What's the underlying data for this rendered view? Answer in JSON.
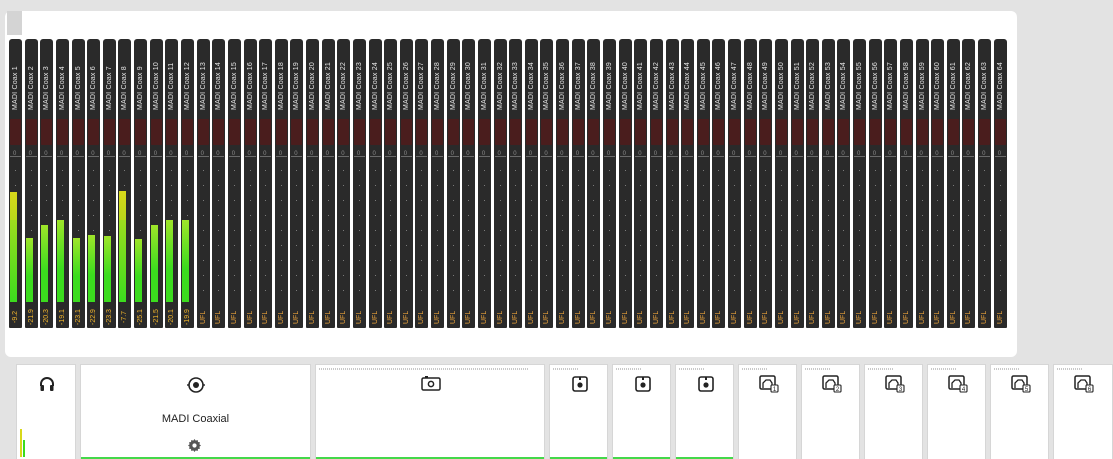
{
  "meter_panel": {
    "channels": [
      {
        "name": "MADI Coax 1",
        "value": "-9.2",
        "level": 0.7,
        "peak_yellow": true
      },
      {
        "name": "MADI Coax 2",
        "value": "-21.9",
        "level": 0.41,
        "peak_yellow": false
      },
      {
        "name": "MADI Coax 3",
        "value": "-20.3",
        "level": 0.49,
        "peak_yellow": false
      },
      {
        "name": "MADI Coax 4",
        "value": "-19.1",
        "level": 0.52,
        "peak_yellow": false
      },
      {
        "name": "MADI Coax 5",
        "value": "-23.1",
        "level": 0.41,
        "peak_yellow": false
      },
      {
        "name": "MADI Coax 6",
        "value": "-22.9",
        "level": 0.43,
        "peak_yellow": false
      },
      {
        "name": "MADI Coax 7",
        "value": "-23.3",
        "level": 0.42,
        "peak_yellow": false
      },
      {
        "name": "MADI Coax 8",
        "value": "-7.7",
        "level": 0.71,
        "peak_yellow": true
      },
      {
        "name": "MADI Coax 9",
        "value": "-25.1",
        "level": 0.4,
        "peak_yellow": false
      },
      {
        "name": "MADI Coax 10",
        "value": "-21.5",
        "level": 0.49,
        "peak_yellow": false
      },
      {
        "name": "MADI Coax 11",
        "value": "-20.1",
        "level": 0.52,
        "peak_yellow": false
      },
      {
        "name": "MADI Coax 12",
        "value": "-19.9",
        "level": 0.52,
        "peak_yellow": false
      },
      {
        "name": "MADI Coax 13",
        "value": "UFL",
        "level": 0
      },
      {
        "name": "MADI Coax 14",
        "value": "UFL",
        "level": 0
      },
      {
        "name": "MADI Coax 15",
        "value": "UFL",
        "level": 0
      },
      {
        "name": "MADI Coax 16",
        "value": "UFL",
        "level": 0
      },
      {
        "name": "MADI Coax 17",
        "value": "UFL",
        "level": 0
      },
      {
        "name": "MADI Coax 18",
        "value": "UFL",
        "level": 0
      },
      {
        "name": "MADI Coax 19",
        "value": "UFL",
        "level": 0
      },
      {
        "name": "MADI Coax 20",
        "value": "UFL",
        "level": 0
      },
      {
        "name": "MADI Coax 21",
        "value": "UFL",
        "level": 0
      },
      {
        "name": "MADI Coax 22",
        "value": "UFL",
        "level": 0
      },
      {
        "name": "MADI Coax 23",
        "value": "UFL",
        "level": 0
      },
      {
        "name": "MADI Coax 24",
        "value": "UFL",
        "level": 0
      },
      {
        "name": "MADI Coax 25",
        "value": "UFL",
        "level": 0
      },
      {
        "name": "MADI Coax 26",
        "value": "UFL",
        "level": 0
      },
      {
        "name": "MADI Coax 27",
        "value": "UFL",
        "level": 0
      },
      {
        "name": "MADI Coax 28",
        "value": "UFL",
        "level": 0
      },
      {
        "name": "MADI Coax 29",
        "value": "UFL",
        "level": 0
      },
      {
        "name": "MADI Coax 30",
        "value": "UFL",
        "level": 0
      },
      {
        "name": "MADI Coax 31",
        "value": "UFL",
        "level": 0
      },
      {
        "name": "MADI Coax 32",
        "value": "UFL",
        "level": 0
      },
      {
        "name": "MADI Coax 33",
        "value": "UFL",
        "level": 0
      },
      {
        "name": "MADI Coax 34",
        "value": "UFL",
        "level": 0
      },
      {
        "name": "MADI Coax 35",
        "value": "UFL",
        "level": 0
      },
      {
        "name": "MADI Coax 36",
        "value": "UFL",
        "level": 0
      },
      {
        "name": "MADI Coax 37",
        "value": "UFL",
        "level": 0
      },
      {
        "name": "MADI Coax 38",
        "value": "UFL",
        "level": 0
      },
      {
        "name": "MADI Coax 39",
        "value": "UFL",
        "level": 0
      },
      {
        "name": "MADI Coax 40",
        "value": "UFL",
        "level": 0
      },
      {
        "name": "MADI Coax 41",
        "value": "UFL",
        "level": 0
      },
      {
        "name": "MADI Coax 42",
        "value": "UFL",
        "level": 0
      },
      {
        "name": "MADI Coax 43",
        "value": "UFL",
        "level": 0
      },
      {
        "name": "MADI Coax 44",
        "value": "UFL",
        "level": 0
      },
      {
        "name": "MADI Coax 45",
        "value": "UFL",
        "level": 0
      },
      {
        "name": "MADI Coax 46",
        "value": "UFL",
        "level": 0
      },
      {
        "name": "MADI Coax 47",
        "value": "UFL",
        "level": 0
      },
      {
        "name": "MADI Coax 48",
        "value": "UFL",
        "level": 0
      },
      {
        "name": "MADI Coax 49",
        "value": "UFL",
        "level": 0
      },
      {
        "name": "MADI Coax 50",
        "value": "UFL",
        "level": 0
      },
      {
        "name": "MADI Coax 51",
        "value": "UFL",
        "level": 0
      },
      {
        "name": "MADI Coax 52",
        "value": "UFL",
        "level": 0
      },
      {
        "name": "MADI Coax 53",
        "value": "UFL",
        "level": 0
      },
      {
        "name": "MADI Coax 54",
        "value": "UFL",
        "level": 0
      },
      {
        "name": "MADI Coax 55",
        "value": "UFL",
        "level": 0
      },
      {
        "name": "MADI Coax 56",
        "value": "UFL",
        "level": 0
      },
      {
        "name": "MADI Coax 57",
        "value": "UFL",
        "level": 0
      },
      {
        "name": "MADI Coax 58",
        "value": "UFL",
        "level": 0
      },
      {
        "name": "MADI Coax 59",
        "value": "UFL",
        "level": 0
      },
      {
        "name": "MADI Coax 60",
        "value": "UFL",
        "level": 0
      },
      {
        "name": "MADI Coax 61",
        "value": "UFL",
        "level": 0
      },
      {
        "name": "MADI Coax 62",
        "value": "UFL",
        "level": 0
      },
      {
        "name": "MADI Coax 63",
        "value": "UFL",
        "level": 0
      },
      {
        "name": "MADI Coax 64",
        "value": "UFL",
        "level": 0
      }
    ],
    "zero_marker": "0"
  },
  "io_bar": {
    "headphones": {
      "icon": "headphones-icon",
      "level_yellow": 0.3,
      "level_green": 0.18
    },
    "madi_coaxial": {
      "icon": "coax-connector-icon",
      "label": "MADI Coaxial",
      "settings_icon": "gear-icon"
    },
    "tiles": [
      {
        "icon": "camera-input-icon"
      },
      {
        "icon": "analog-input-icon"
      },
      {
        "icon": "analog-input-icon"
      },
      {
        "icon": "analog-input-icon"
      },
      {
        "icon": "network-port-icon",
        "number": "1"
      },
      {
        "icon": "network-port-icon",
        "number": "2"
      },
      {
        "icon": "network-port-icon",
        "number": "3"
      },
      {
        "icon": "network-port-icon",
        "number": "4"
      },
      {
        "icon": "network-port-icon",
        "number": "5"
      },
      {
        "icon": "network-port-icon",
        "number": "6"
      }
    ],
    "colors": {
      "active": "#44d84a",
      "meter_green": "#3bdc1e",
      "meter_yellow": "#d8d81a",
      "value_text": "#f0b42b"
    }
  }
}
